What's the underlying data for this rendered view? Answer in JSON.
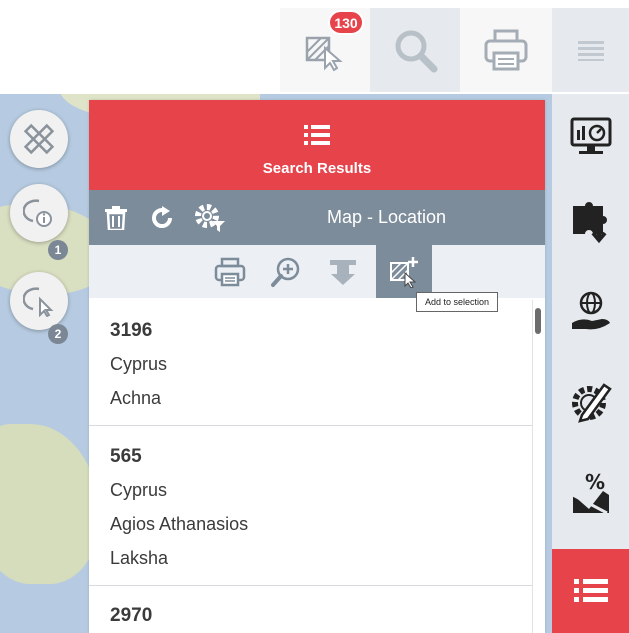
{
  "toolbar": {
    "selection_count": "130",
    "buttons": [
      "selection-tool",
      "search",
      "print",
      "menu"
    ]
  },
  "map_tools": {
    "badge_1": "1",
    "badge_2": "2"
  },
  "panel": {
    "title": "Search Results",
    "subtitle": "Map - Location",
    "tooltip": "Add to selection"
  },
  "results": [
    {
      "id": "3196",
      "lines": [
        "Cyprus",
        "Achna"
      ]
    },
    {
      "id": "565",
      "lines": [
        "Cyprus",
        "Agios Athanasios",
        "Laksha"
      ]
    },
    {
      "id": "2970",
      "lines": []
    }
  ],
  "colors": {
    "accent": "#e6434b",
    "toolbar": "#7d8c9b",
    "sidebar": "#e6e9ed"
  }
}
